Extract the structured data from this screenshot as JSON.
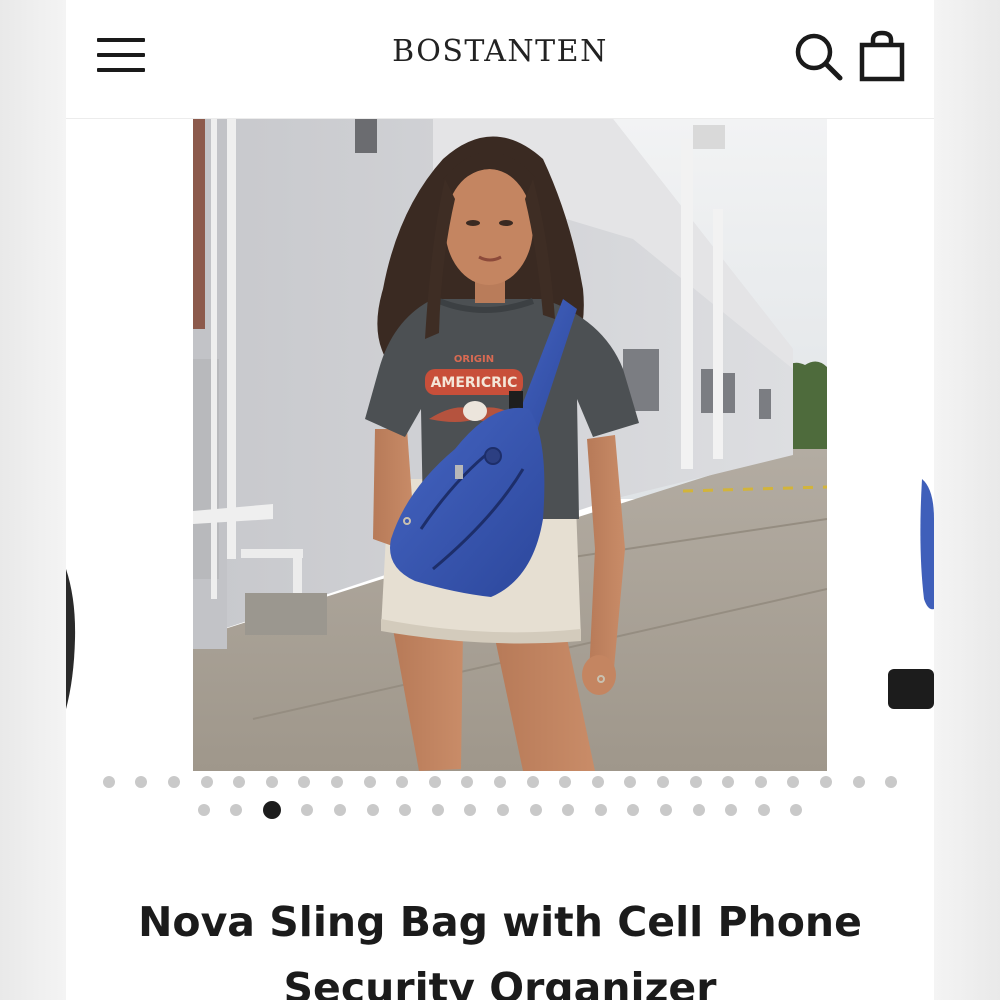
{
  "header": {
    "brand": "BOSTANTEN",
    "icons": [
      "menu-icon",
      "search-icon",
      "shopping-bag-icon"
    ]
  },
  "carousel": {
    "slide_count": 44,
    "active_index": 27,
    "rows": [
      25,
      19
    ],
    "shirt_text_top": "ORIGIN",
    "shirt_text_main": "AMERICRIC"
  },
  "product": {
    "title_line1": "Nova Sling Bag with Cell Phone",
    "title_line2": "Security Organizer"
  },
  "colors": {
    "text": "#1b1b1b",
    "bag_blue": "#3a58b4",
    "dot_inactive": "#c9c9c9",
    "dot_active": "#1c1c1c"
  }
}
